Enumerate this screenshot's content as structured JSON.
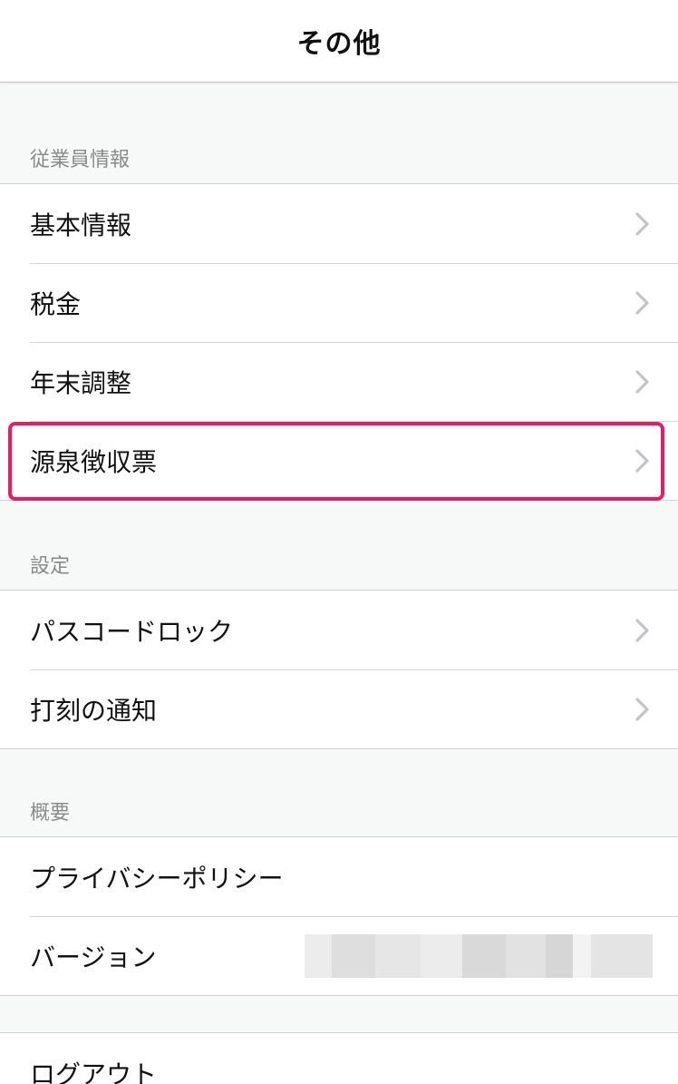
{
  "nav": {
    "title": "その他"
  },
  "sections": [
    {
      "header": "従業員情報",
      "items": [
        {
          "label": "基本情報"
        },
        {
          "label": "税金"
        },
        {
          "label": "年末調整"
        },
        {
          "label": "源泉徴収票"
        }
      ]
    },
    {
      "header": "設定",
      "items": [
        {
          "label": "パスコードロック"
        },
        {
          "label": "打刻の通知"
        }
      ]
    },
    {
      "header": "概要",
      "items": [
        {
          "label": "プライバシーポリシー"
        },
        {
          "label": "バージョン"
        }
      ]
    }
  ],
  "logout": {
    "label": "ログアウト"
  },
  "colors": {
    "highlight": "#f2185f",
    "logout": "#c9303a",
    "chevron": "#c4c4c8"
  }
}
